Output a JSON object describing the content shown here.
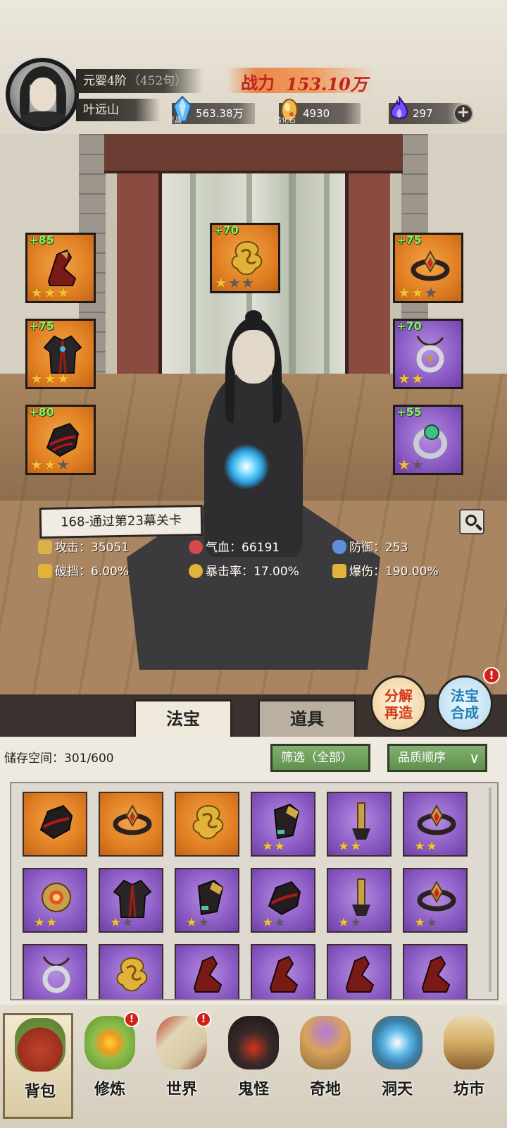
{
  "player": {
    "realm": "元婴4阶",
    "realm_sub": "（452句）",
    "name": "叶远山"
  },
  "power": {
    "label": "战力",
    "value": "153.10万"
  },
  "currencies": [
    {
      "icon": "spirit-crystal-icon",
      "caption": "灵晶",
      "value": "563.38万"
    },
    {
      "icon": "creation-stone-icon",
      "caption": "造化石",
      "value": "4930"
    },
    {
      "icon": "purple-flame-icon",
      "caption": "",
      "value": "297"
    }
  ],
  "equipment": {
    "left": [
      {
        "level": "+85",
        "rarity": "orange",
        "stars": 3,
        "max_stars": 3,
        "icon": "boot-icon"
      },
      {
        "level": "+75",
        "rarity": "orange",
        "stars": 3,
        "max_stars": 3,
        "icon": "robe-icon"
      },
      {
        "level": "+80",
        "rarity": "orange",
        "stars": 2,
        "max_stars": 3,
        "icon": "gauntlet-icon"
      }
    ],
    "center": {
      "level": "+70",
      "rarity": "orange",
      "stars": 1,
      "max_stars": 3,
      "icon": "golden-cloud-icon"
    },
    "right": [
      {
        "level": "+75",
        "rarity": "orange",
        "stars": 2,
        "max_stars": 3,
        "icon": "crown-icon"
      },
      {
        "level": "+70",
        "rarity": "purple",
        "stars": 2,
        "max_stars": 2,
        "icon": "pendant-icon"
      },
      {
        "level": "+55",
        "rarity": "purple",
        "stars": 1,
        "max_stars": 2,
        "icon": "ring-icon"
      }
    ]
  },
  "stage_tag": "168-通过第23幕关卡",
  "stats": {
    "attack": "攻击：35051",
    "hp": "气血：66191",
    "defense": "防御：253",
    "break": "破挡：6.00%",
    "crit_rate": "暴击率：17.00%",
    "crit_dmg": "爆伤：190.00%"
  },
  "tabs": {
    "fabao": "法宝",
    "daoju": "道具"
  },
  "buttons": {
    "decompose_l1": "分解",
    "decompose_l2": "再造",
    "combine_l1": "法宝",
    "combine_l2": "合成",
    "badge": "!"
  },
  "inventory": {
    "storage_label": "储存空间：301/600",
    "filter": "筛选（全部）",
    "sort": "品质顺序",
    "items": [
      {
        "rarity": "orange",
        "icon": "gauntlet-icon",
        "stars": 0
      },
      {
        "rarity": "orange",
        "icon": "crown-icon",
        "stars": 0
      },
      {
        "rarity": "orange",
        "icon": "golden-cloud-icon",
        "stars": 0
      },
      {
        "rarity": "purple",
        "icon": "bracer-icon",
        "stars": 2,
        "max_stars": 2
      },
      {
        "rarity": "purple",
        "icon": "belt-icon",
        "stars": 2,
        "max_stars": 2
      },
      {
        "rarity": "purple",
        "icon": "crown-icon",
        "stars": 2,
        "max_stars": 2
      },
      {
        "rarity": "purple",
        "icon": "sun-amulet-icon",
        "stars": 2,
        "max_stars": 2
      },
      {
        "rarity": "purple",
        "icon": "robe-icon",
        "stars": 1,
        "max_stars": 2
      },
      {
        "rarity": "purple",
        "icon": "bracer-icon",
        "stars": 1,
        "max_stars": 2
      },
      {
        "rarity": "purple",
        "icon": "gauntlet-icon",
        "stars": 1,
        "max_stars": 2
      },
      {
        "rarity": "purple",
        "icon": "belt-icon",
        "stars": 1,
        "max_stars": 2
      },
      {
        "rarity": "purple",
        "icon": "crown-icon",
        "stars": 1,
        "max_stars": 2
      },
      {
        "rarity": "purple",
        "icon": "pendant-icon",
        "stars": 0
      },
      {
        "rarity": "purple",
        "icon": "golden-cloud-icon",
        "stars": 0
      },
      {
        "rarity": "purple",
        "icon": "boot-icon",
        "stars": 0
      },
      {
        "rarity": "purple",
        "icon": "boot-icon",
        "stars": 0
      },
      {
        "rarity": "purple",
        "icon": "boot-icon",
        "stars": 0
      },
      {
        "rarity": "purple",
        "icon": "boot-icon",
        "stars": 0
      }
    ]
  },
  "nav": [
    {
      "label": "背包",
      "icon": "bag-icon",
      "badge": ""
    },
    {
      "label": "修炼",
      "icon": "lotus-icon",
      "badge": "!"
    },
    {
      "label": "世界",
      "icon": "scroll-map-icon",
      "badge": "!"
    },
    {
      "label": "鬼怪",
      "icon": "demon-egg-icon",
      "badge": ""
    },
    {
      "label": "奇地",
      "icon": "floating-isle-icon",
      "badge": ""
    },
    {
      "label": "洞天",
      "icon": "portal-icon",
      "badge": ""
    },
    {
      "label": "坊市",
      "icon": "market-stall-icon",
      "badge": ""
    }
  ],
  "colors": {
    "orange_rarity": "#e07f22",
    "purple_rarity": "#8b5bc4",
    "level_text": "#8cf06a",
    "power_text": "#c0241b",
    "star_on": "#f2c232"
  }
}
